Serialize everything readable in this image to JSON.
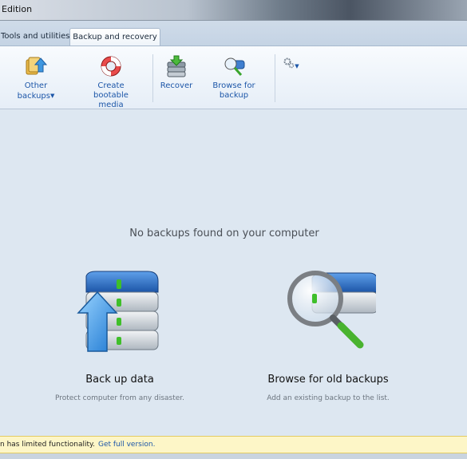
{
  "window": {
    "title": "Edition"
  },
  "tabs": [
    {
      "label": "Tools and utilities"
    },
    {
      "label": "Backup and recovery"
    }
  ],
  "ribbon": {
    "other_backups": "Other backups",
    "create_bootable_media": "Create bootable media",
    "recover": "Recover",
    "browse_for_backup": "Browse for backup",
    "settings_icon": "gear-icon"
  },
  "main": {
    "empty_message": "No backups found on your computer",
    "backup": {
      "label": "Back up data",
      "description": "Protect computer from any disaster."
    },
    "browse": {
      "label": "Browse for old backups",
      "description": "Add an existing backup to the list."
    }
  },
  "infobar": {
    "text": "n has limited functionality.",
    "link": "Get full version."
  },
  "colors": {
    "accent": "#1c56a8",
    "infobar_bg": "#fdf6c7"
  }
}
